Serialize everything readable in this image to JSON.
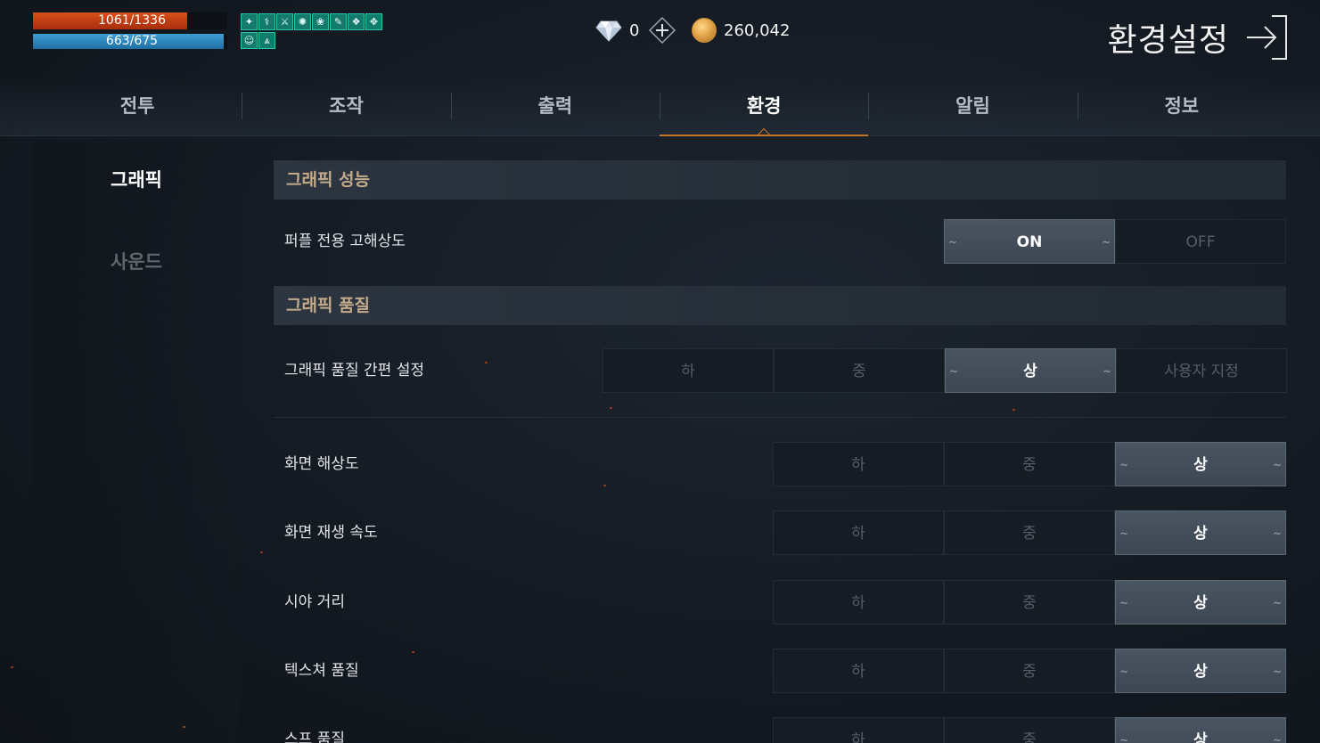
{
  "hud": {
    "hp_text": "1061/1336",
    "hp_fraction": 0.794,
    "mp_text": "663/675",
    "mp_fraction": 0.982,
    "buff_icons_row1": [
      "buff-icon-1",
      "buff-icon-2",
      "buff-icon-3",
      "buff-icon-4",
      "buff-icon-5",
      "buff-icon-6",
      "buff-icon-7",
      "buff-icon-8"
    ],
    "buff_icons_row2": [
      "buff-icon-9",
      "buff-icon-10"
    ]
  },
  "currency": {
    "gem_value": "0",
    "gold_value": "260,042"
  },
  "header": {
    "title": "환경설정"
  },
  "tabs": [
    {
      "label": "전투",
      "active": false
    },
    {
      "label": "조작",
      "active": false
    },
    {
      "label": "출력",
      "active": false
    },
    {
      "label": "환경",
      "active": true
    },
    {
      "label": "알림",
      "active": false
    },
    {
      "label": "정보",
      "active": false
    }
  ],
  "sidebar": {
    "items": [
      {
        "label": "그래픽",
        "active": true
      },
      {
        "label": "사운드",
        "active": false
      }
    ]
  },
  "sections": {
    "performance": {
      "title": "그래픽 성능",
      "rows": [
        {
          "label": "퍼플 전용 고해상도",
          "options": [
            "ON",
            "OFF"
          ],
          "selected": "ON"
        }
      ]
    },
    "quality": {
      "title": "그래픽 품질",
      "preset": {
        "label": "그래픽 품질 간편 설정",
        "options": [
          "하",
          "중",
          "상",
          "사용자 지정"
        ],
        "selected": "상"
      },
      "rows": [
        {
          "label": "화면 해상도",
          "options": [
            "하",
            "중",
            "상"
          ],
          "selected": "상"
        },
        {
          "label": "화면 재생 속도",
          "options": [
            "하",
            "중",
            "상"
          ],
          "selected": "상"
        },
        {
          "label": "시야 거리",
          "options": [
            "하",
            "중",
            "상"
          ],
          "selected": "상"
        },
        {
          "label": "텍스쳐 품질",
          "options": [
            "하",
            "중",
            "상"
          ],
          "selected": "상"
        },
        {
          "label": "스프 품질",
          "options": [
            "하",
            "중",
            "상"
          ],
          "selected": "상"
        }
      ]
    }
  },
  "colors": {
    "accent": "#c8752a",
    "hp_bar": "#c43f14",
    "mp_bar": "#2f8bc2",
    "section_title": "#c2ab8a",
    "buff_bg": "#137a6c"
  }
}
